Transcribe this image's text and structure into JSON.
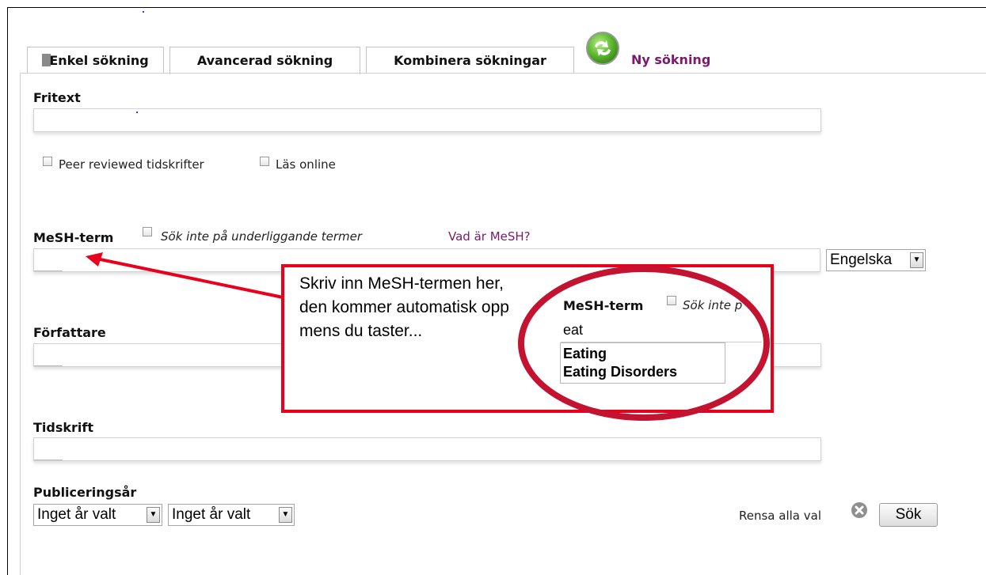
{
  "tabs": {
    "simple": "Enkel sökning",
    "advanced": "Avancerad sökning",
    "combine": "Kombinera sökningar",
    "new_search": "Ny sökning"
  },
  "fritext": {
    "label": "Fritext",
    "value": ""
  },
  "filters": {
    "peer_reviewed": "Peer reviewed tidskrifter",
    "read_online": "Läs online"
  },
  "mesh": {
    "label": "MeSH-term",
    "no_sub_terms": "Sök inte på underliggande termer",
    "what_is": "Vad är MeSH?",
    "value": "",
    "language": "Engelska"
  },
  "author": {
    "label": "Författare",
    "value": ""
  },
  "journal": {
    "label": "Tidskrift",
    "value": ""
  },
  "year": {
    "label": "Publiceringsår",
    "from": "Inget år valt",
    "to": "Inget år valt"
  },
  "actions": {
    "clear_all": "Rensa alla val",
    "search": "Sök"
  },
  "callout": {
    "text": "Skriv inn MeSH-termen her, den kommer automatisk opp mens du taster...",
    "inset_label": "MeSH-term",
    "inset_checkbox_text": "Sök inte p",
    "inset_value": "eat",
    "suggestions": [
      "Eating",
      "Eating Disorders"
    ]
  },
  "colors": {
    "link": "#7a1a6b",
    "callout_border": "#e8001c",
    "highlight_ellipse": "#c41231",
    "arrow": "#e8001c",
    "new_search_icon": "#5cb82e"
  }
}
